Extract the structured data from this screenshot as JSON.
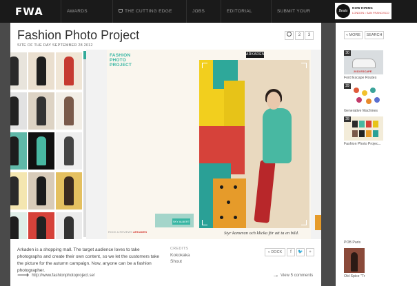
{
  "topnav": {
    "logo": "FWA",
    "items": [
      {
        "label": "AWARDS"
      },
      {
        "label": "THE CUTTING EDGE AWARD"
      },
      {
        "label": "JOBS"
      },
      {
        "label": "EDITORIAL"
      },
      {
        "label": "SUBMIT YOUR PROJECT"
      }
    ],
    "ad": {
      "brand": "Beats",
      "line1": "NOW HIRING",
      "line2": "LONDON • SAN FRANCISCO"
    }
  },
  "header": {
    "title": "Fashion Photo Project",
    "subtitle": "SITE OF THE DAY SEPTEMBER 28 2012",
    "pages": [
      "2",
      "3"
    ]
  },
  "preview": {
    "logo_line1": "FASHION",
    "logo_line2": "PHOTO",
    "logo_line3": "PROJECT",
    "badge": "ARKADEN",
    "caption": "Styr kameran och klicka för att ta en bild.",
    "footer_left": "ROCK & REVIEWS",
    "footer_brand": "ARKADEN",
    "send_label": "SKY ALBERT"
  },
  "details": {
    "description": "Arkaden is a shopping mall. The target audience loves to take photographs and create their own content, so we let the customers take the picture for the autumn campaign. Now, anyone can be a fashion photographer.",
    "credits_label": "CREDITS",
    "credits": [
      "Kokokaka",
      "Shout"
    ],
    "dock_label": "« DOCK",
    "social": [
      "f",
      "🐦",
      "+"
    ],
    "url": "http://www.fashionphotoproject.se/",
    "comments": "View 5 comments"
  },
  "sidebar": {
    "more_label": "« MORE",
    "search_label": "SEARCH",
    "items": [
      {
        "num": "30",
        "label": "Ford Escape Routes",
        "tag": "2013 ESCAPE"
      },
      {
        "num": "29",
        "label": "Generative Machines"
      },
      {
        "num": "28",
        "label": "Fashion Photo Projec..."
      }
    ],
    "bottom_items": [
      {
        "label": "POB Paris"
      },
      {
        "label": "Old Spice \"Tr"
      }
    ]
  },
  "colors": {
    "accent_teal": "#37b6a3",
    "nav_bg": "#1a1a1a",
    "page_bg": "#4a4a4a"
  }
}
